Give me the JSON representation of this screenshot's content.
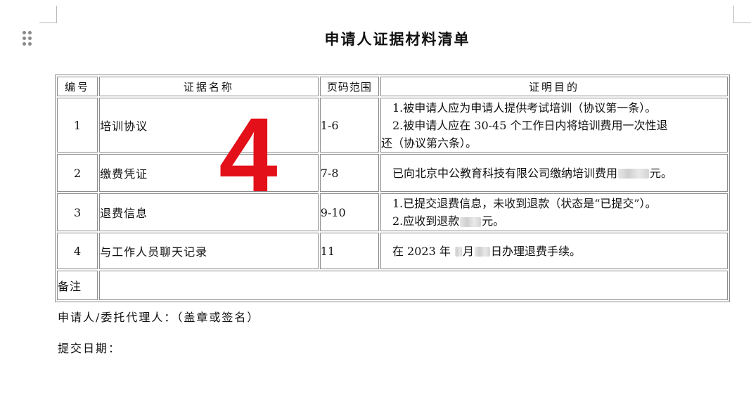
{
  "title": "申请人证据材料清单",
  "table": {
    "headers": {
      "number": "编号",
      "name": "证据名称",
      "pages": "页码范围",
      "purpose": "证明目的"
    },
    "rows": [
      {
        "number": "1",
        "name": "培训协议",
        "pages": "1-6",
        "purpose_line1": "1.被申请人应为申请人提供考试培训（协议第一条）。",
        "purpose_line2a": "2.被申请人应在 30-45 个工作日内将培训费用一次性退",
        "purpose_line2b": "还（协议第六条）。"
      },
      {
        "number": "2",
        "name": "缴费凭证",
        "pages": "7-8",
        "purpose_before": "已向北京中公教育科技有限公司缴纳培训费用",
        "purpose_after": "元。"
      },
      {
        "number": "3",
        "name": "退费信息",
        "pages": "9-10",
        "purpose_line1": "1.已提交退费信息，未收到退款（状态是“已提交”）。",
        "purpose_line2_before": "2.应收到退款",
        "purpose_line2_after": "元。"
      },
      {
        "number": "4",
        "name": "与工作人员聊天记录",
        "pages": "11",
        "purpose_a": "在 2023 年",
        "purpose_b": "月",
        "purpose_c": "日办理退费手续。"
      }
    ],
    "remarks_label": "备注",
    "remarks_value": ""
  },
  "overlay_mark": "4",
  "footer": {
    "signer": "申请人/委托代理人：（盖章或签名）",
    "date": "提交日期："
  },
  "colors": {
    "overlay_mark": "#e3101a",
    "table_border": "#8c8c8c"
  }
}
